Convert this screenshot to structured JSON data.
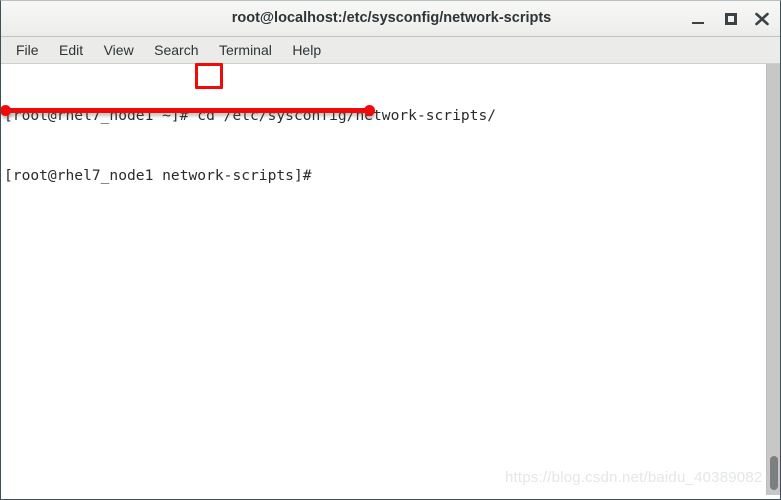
{
  "window": {
    "title": "root@localhost:/etc/sysconfig/network-scripts",
    "controls": {
      "minimize_label": "Minimize",
      "maximize_label": "Maximize",
      "close_label": "Close"
    }
  },
  "menubar": {
    "items": [
      {
        "label": "File"
      },
      {
        "label": "Edit"
      },
      {
        "label": "View"
      },
      {
        "label": "Search"
      },
      {
        "label": "Terminal"
      },
      {
        "label": "Help"
      }
    ]
  },
  "terminal": {
    "lines": [
      "[root@rhel7_node1 ~]# cd /etc/sysconfig/network-scripts/",
      "[root@rhel7_node1 network-scripts]#"
    ],
    "prompt_user": "root",
    "prompt_host": "rhel7_node1",
    "command": "cd",
    "command_argument": "/etc/sysconfig/network-scripts/",
    "working_directory": "network-scripts",
    "background_color": "#ffffff",
    "text_color": "#2b2b2b"
  },
  "annotations": {
    "highlight_box": {
      "target_text": "cd",
      "color": "#f20a0a"
    },
    "underline_marker": {
      "color": "#f20a0a",
      "target_text": "[root@rhel7_node1 network-scripts]#"
    }
  },
  "scrollbar": {
    "orientation": "vertical",
    "position": "bottom"
  },
  "watermark": {
    "text": "https://blog.csdn.net/baidu_40389082"
  }
}
